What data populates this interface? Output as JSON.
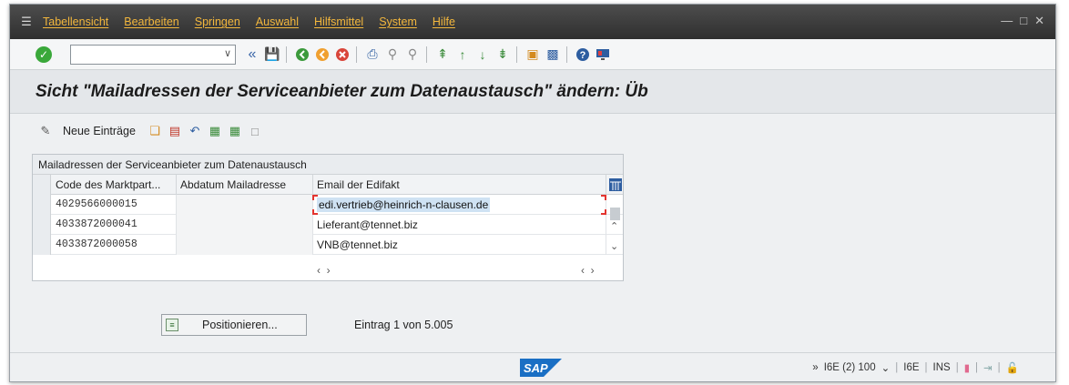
{
  "menubar": {
    "items": [
      "Tabellensicht",
      "Bearbeiten",
      "Springen",
      "Auswahl",
      "Hilfsmittel",
      "System",
      "Hilfe"
    ],
    "window_controls": [
      "minimize",
      "maximize",
      "close"
    ]
  },
  "toolbar": {
    "command_value": "",
    "icons": [
      "enter-icon",
      "command-dropdown",
      "back-double-icon",
      "save-icon",
      "back-icon",
      "exit-icon",
      "cancel-icon",
      "print-icon",
      "find-icon",
      "find-next-icon",
      "first-page-icon",
      "previous-page-icon",
      "next-page-icon",
      "last-page-icon",
      "new-session-icon",
      "shortcut-icon",
      "help-icon",
      "layout-icon"
    ]
  },
  "title": "Sicht \"Mailadressen der Serviceanbieter zum Datenaustausch\" ändern: Üb",
  "app_toolbar": {
    "new_entries_label": "Neue Einträge",
    "icons": [
      "copy-icon",
      "delete-icon",
      "undo-icon",
      "select-all-icon",
      "select-block-icon",
      "deselect-all-icon"
    ]
  },
  "table": {
    "title": "Mailadressen der Serviceanbieter zum Datenaustausch",
    "columns": [
      "Code des Marktpart...",
      "Abdatum Mailadresse",
      "Email der Edifakt"
    ],
    "rows": [
      {
        "code": "4029566000015",
        "abdatum": "",
        "email": "edi.vertrieb@heinrich-n-clausen.de"
      },
      {
        "code": "4033872000041",
        "abdatum": "",
        "email": "Lieferant@tennet.biz"
      },
      {
        "code": "4033872000058",
        "abdatum": "",
        "email": "VNB@tennet.biz"
      }
    ]
  },
  "positionieren_label": "Positionieren...",
  "entry_info": "Eintrag 1 von 5.005",
  "status": {
    "logo": "SAP",
    "system": "I6E (2) 100",
    "server": "I6E",
    "mode": "INS"
  },
  "colors": {
    "menubar": "#3a3a3a",
    "menu_text": "#f3b73d",
    "selection": "#cfe2f3",
    "focus": "#e3342f",
    "sap_blue": "#1a6fc4"
  }
}
